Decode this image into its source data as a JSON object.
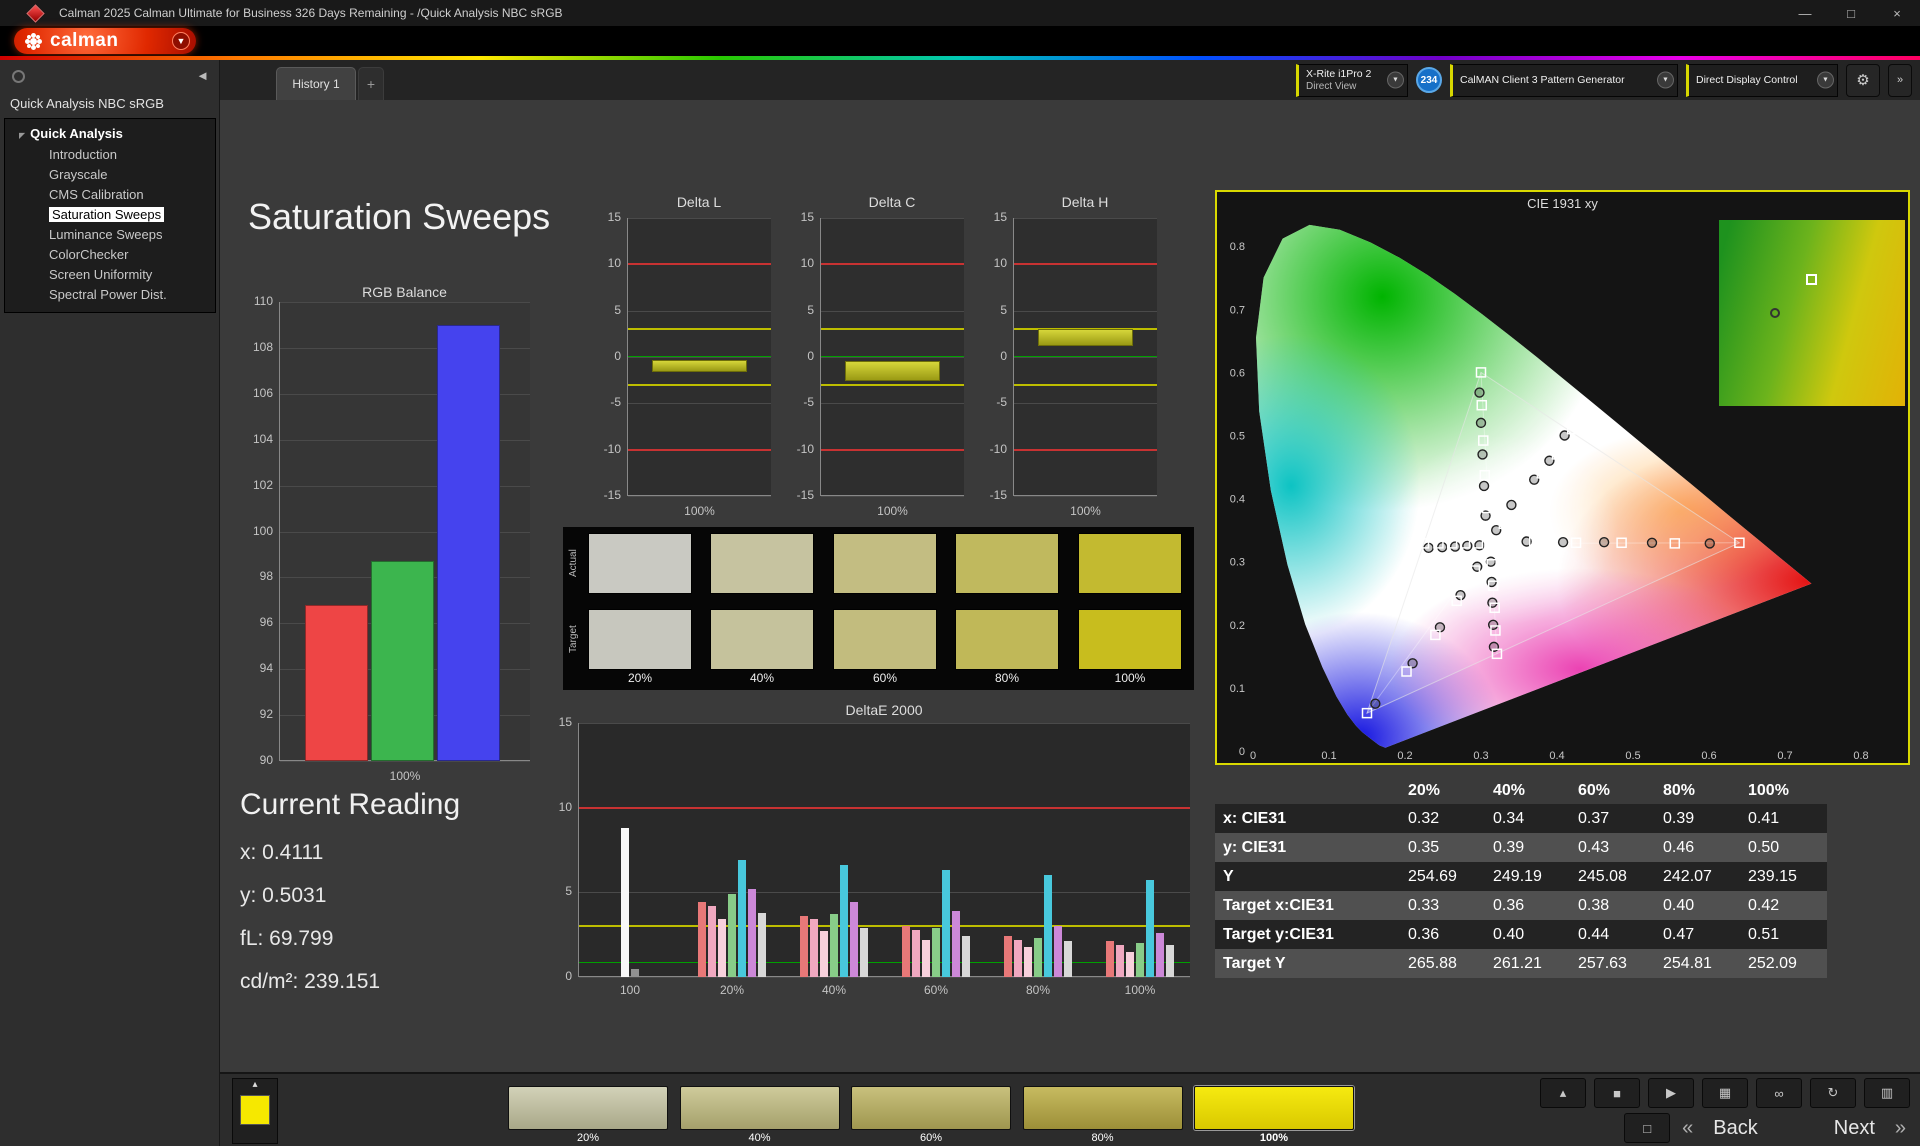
{
  "window": {
    "title": "Calman 2025 Calman Ultimate for Business 326 Days Remaining  - /Quick Analysis NBC sRGB",
    "controls": {
      "minimize": "—",
      "maximize": "□",
      "close": "×"
    }
  },
  "logo": {
    "brand": "calman"
  },
  "sidebar": {
    "panel_title": "Quick Analysis NBC sRGB",
    "tree_root": "Quick Analysis",
    "items": [
      {
        "label": "Introduction",
        "selected": false
      },
      {
        "label": "Grayscale",
        "selected": false
      },
      {
        "label": "CMS Calibration",
        "selected": false
      },
      {
        "label": "Saturation Sweeps",
        "selected": true
      },
      {
        "label": "Luminance Sweeps",
        "selected": false
      },
      {
        "label": "ColorChecker",
        "selected": false
      },
      {
        "label": "Screen Uniformity",
        "selected": false
      },
      {
        "label": "Spectral Power Dist.",
        "selected": false
      }
    ]
  },
  "tabbar": {
    "tab": "History 1",
    "add_tab": "+",
    "meter": {
      "line1": "X-Rite i1Pro 2",
      "line2": "Direct View"
    },
    "badge": "234",
    "pattern_generator": "CalMAN Client 3 Pattern Generator",
    "display_control": "Direct Display Control"
  },
  "page": {
    "title": "Saturation Sweeps"
  },
  "current_reading": {
    "title": "Current Reading",
    "lines": [
      "x: 0.4111",
      "y: 0.5031",
      "fL: 69.799",
      "cd/m²: 239.151"
    ]
  },
  "swatches": {
    "row_labels": [
      "Actual",
      "Target"
    ],
    "labels": [
      "20%",
      "40%",
      "60%",
      "80%",
      "100%"
    ],
    "actual": [
      "#c9c9c2",
      "#c6c3a0",
      "#c3bd82",
      "#c0b95e",
      "#c3ba30"
    ],
    "target": [
      "#c7c7be",
      "#c5c29c",
      "#c2bc7e",
      "#c0b858",
      "#c8bd1e"
    ]
  },
  "table": {
    "headers": [
      "",
      "20%",
      "40%",
      "60%",
      "80%",
      "100%"
    ],
    "rows": [
      {
        "label": "x: CIE31",
        "values": [
          "0.32",
          "0.34",
          "0.37",
          "0.39",
          "0.41"
        ]
      },
      {
        "label": "y: CIE31",
        "values": [
          "0.35",
          "0.39",
          "0.43",
          "0.46",
          "0.50"
        ]
      },
      {
        "label": "Y",
        "values": [
          "254.69",
          "249.19",
          "245.08",
          "242.07",
          "239.15"
        ]
      },
      {
        "label": "Target x:CIE31",
        "values": [
          "0.33",
          "0.36",
          "0.38",
          "0.40",
          "0.42"
        ]
      },
      {
        "label": "Target y:CIE31",
        "values": [
          "0.36",
          "0.40",
          "0.44",
          "0.47",
          "0.51"
        ]
      },
      {
        "label": "Target Y",
        "values": [
          "265.88",
          "261.21",
          "257.63",
          "254.81",
          "252.09"
        ]
      }
    ]
  },
  "bottombar": {
    "back": "Back",
    "next": "Next",
    "patches": [
      {
        "label": "20%",
        "top": "#d2d2b8",
        "bottom": "#a9a888",
        "selected": false
      },
      {
        "label": "40%",
        "top": "#cfcb9b",
        "bottom": "#a5a06b",
        "selected": false
      },
      {
        "label": "60%",
        "top": "#c9c17d",
        "bottom": "#9f964f",
        "selected": false
      },
      {
        "label": "80%",
        "top": "#c7bb60",
        "bottom": "#9c8f38",
        "selected": false
      },
      {
        "label": "100%",
        "top": "#f6ea10",
        "bottom": "#d9c900",
        "selected": true
      }
    ],
    "controls_top": [
      {
        "name": "collapse-up",
        "glyph": "▴"
      },
      {
        "name": "stop",
        "glyph": "■"
      },
      {
        "name": "play",
        "glyph": "▶"
      },
      {
        "name": "save",
        "glyph": "▦"
      },
      {
        "name": "loop",
        "glyph": "∞"
      },
      {
        "name": "refresh",
        "glyph": "↻"
      },
      {
        "name": "grid",
        "glyph": "▥"
      }
    ]
  },
  "chart_data": [
    {
      "id": "rgb_balance",
      "type": "bar",
      "title": "RGB Balance",
      "categories": [
        "100%"
      ],
      "ylim": [
        90,
        110
      ],
      "ytick": 2,
      "series": [
        {
          "name": "Red",
          "color": "#ee4545",
          "values": [
            96.8
          ]
        },
        {
          "name": "Green",
          "color": "#3cb54e",
          "values": [
            98.7
          ]
        },
        {
          "name": "Blue",
          "color": "#4543ee",
          "values": [
            109.0
          ]
        }
      ]
    },
    {
      "id": "delta_l",
      "type": "range-bar",
      "title": "Delta L",
      "xlabel": "100%",
      "ylim": [
        -15,
        15
      ],
      "ytick": 5,
      "limits": {
        "red": [
          10,
          -10
        ],
        "yellow": [
          3,
          -3
        ],
        "green": [
          0
        ]
      },
      "bar": {
        "from": -1.6,
        "to": -0.3
      }
    },
    {
      "id": "delta_c",
      "type": "range-bar",
      "title": "Delta C",
      "xlabel": "100%",
      "ylim": [
        -15,
        15
      ],
      "ytick": 5,
      "limits": {
        "red": [
          10,
          -10
        ],
        "yellow": [
          3,
          -3
        ],
        "green": [
          0
        ]
      },
      "bar": {
        "from": -2.6,
        "to": -0.4
      }
    },
    {
      "id": "delta_h",
      "type": "range-bar",
      "title": "Delta H",
      "xlabel": "100%",
      "ylim": [
        -15,
        15
      ],
      "ytick": 5,
      "limits": {
        "red": [
          10,
          -10
        ],
        "yellow": [
          3,
          -3
        ],
        "green": [
          0
        ]
      },
      "bar": {
        "from": 1.2,
        "to": 3.0
      }
    },
    {
      "id": "deltae2000",
      "type": "grouped-bar",
      "title": "DeltaE 2000",
      "ylim": [
        0,
        15
      ],
      "ytick": 5,
      "limits": {
        "red": [
          10
        ],
        "yellow": [
          3
        ],
        "green": [
          0.8
        ]
      },
      "groups": [
        {
          "label": "100",
          "bars": [
            {
              "color": "#f8f8f8",
              "value": 8.8
            },
            {
              "color": "#909090",
              "value": 0.5
            }
          ]
        },
        {
          "label": "20%",
          "bars": [
            {
              "color": "#e87878",
              "value": 4.4
            },
            {
              "color": "#f0a8c0",
              "value": 4.2
            },
            {
              "color": "#f8d0dc",
              "value": 3.4
            },
            {
              "color": "#88cc88",
              "value": 4.9
            },
            {
              "color": "#48c8dc",
              "value": 6.9
            },
            {
              "color": "#cc88d8",
              "value": 5.2
            },
            {
              "color": "#d8d8d8",
              "value": 3.8
            }
          ]
        },
        {
          "label": "40%",
          "bars": [
            {
              "color": "#e87878",
              "value": 3.6
            },
            {
              "color": "#f0a8c0",
              "value": 3.4
            },
            {
              "color": "#f8d0dc",
              "value": 2.7
            },
            {
              "color": "#88cc88",
              "value": 3.7
            },
            {
              "color": "#48c8dc",
              "value": 6.6
            },
            {
              "color": "#cc88d8",
              "value": 4.4
            },
            {
              "color": "#d8d8d8",
              "value": 2.9
            }
          ]
        },
        {
          "label": "60%",
          "bars": [
            {
              "color": "#e87878",
              "value": 3.0
            },
            {
              "color": "#f0a8c0",
              "value": 2.8
            },
            {
              "color": "#f8d0dc",
              "value": 2.2
            },
            {
              "color": "#88cc88",
              "value": 2.9
            },
            {
              "color": "#48c8dc",
              "value": 6.3
            },
            {
              "color": "#cc88d8",
              "value": 3.9
            },
            {
              "color": "#d8d8d8",
              "value": 2.4
            }
          ]
        },
        {
          "label": "80%",
          "bars": [
            {
              "color": "#e87878",
              "value": 2.4
            },
            {
              "color": "#f0a8c0",
              "value": 2.2
            },
            {
              "color": "#f8d0dc",
              "value": 1.8
            },
            {
              "color": "#88cc88",
              "value": 2.3
            },
            {
              "color": "#48c8dc",
              "value": 6.0
            },
            {
              "color": "#cc88d8",
              "value": 3.0
            },
            {
              "color": "#d8d8d8",
              "value": 2.1
            }
          ]
        },
        {
          "label": "100%",
          "bars": [
            {
              "color": "#e87878",
              "value": 2.1
            },
            {
              "color": "#f0a8c0",
              "value": 1.9
            },
            {
              "color": "#f8d0dc",
              "value": 1.5
            },
            {
              "color": "#88cc88",
              "value": 2.0
            },
            {
              "color": "#48c8dc",
              "value": 5.7
            },
            {
              "color": "#cc88d8",
              "value": 2.6
            },
            {
              "color": "#d8d8d8",
              "value": 1.9
            }
          ]
        }
      ]
    },
    {
      "id": "cie1931",
      "type": "scatter",
      "title": "CIE 1931 xy",
      "xlim": [
        0,
        0.8
      ],
      "ylim": [
        0,
        0.8
      ],
      "tick": 0.1,
      "white_point": [
        0.3127,
        0.329
      ],
      "srgb_triangle": [
        [
          0.64,
          0.33
        ],
        [
          0.3,
          0.6
        ],
        [
          0.15,
          0.06
        ]
      ],
      "inset_markers": {
        "circle": [
          0.3,
          0.5
        ],
        "square": [
          0.5,
          0.32
        ]
      },
      "sweeps": [
        {
          "name": "red",
          "targets": [
            [
              0.37,
              0.331
            ],
            [
              0.425,
              0.33
            ],
            [
              0.485,
              0.33
            ],
            [
              0.555,
              0.329
            ],
            [
              0.64,
              0.33
            ]
          ],
          "measured": [
            [
              0.36,
              0.332
            ],
            [
              0.408,
              0.331
            ],
            [
              0.462,
              0.331
            ],
            [
              0.525,
              0.33
            ],
            [
              0.601,
              0.329
            ]
          ]
        },
        {
          "name": "green",
          "targets": [
            [
              0.308,
              0.385
            ],
            [
              0.305,
              0.437
            ],
            [
              0.303,
              0.492
            ],
            [
              0.301,
              0.548
            ],
            [
              0.3,
              0.6
            ]
          ],
          "measured": [
            [
              0.306,
              0.373
            ],
            [
              0.304,
              0.42
            ],
            [
              0.302,
              0.47
            ],
            [
              0.3,
              0.52
            ],
            [
              0.298,
              0.568
            ]
          ]
        },
        {
          "name": "blue",
          "targets": [
            [
              0.292,
              0.286
            ],
            [
              0.268,
              0.238
            ],
            [
              0.24,
              0.184
            ],
            [
              0.202,
              0.126
            ],
            [
              0.15,
              0.06
            ]
          ],
          "measured": [
            [
              0.295,
              0.292
            ],
            [
              0.273,
              0.247
            ],
            [
              0.246,
              0.196
            ],
            [
              0.21,
              0.139
            ],
            [
              0.161,
              0.075
            ]
          ]
        },
        {
          "name": "cyan",
          "targets": [
            [
              0.296,
              0.329
            ],
            [
              0.279,
              0.329
            ],
            [
              0.262,
              0.329
            ],
            [
              0.244,
              0.329
            ],
            [
              0.225,
              0.329
            ]
          ],
          "measured": [
            [
              0.298,
              0.326
            ],
            [
              0.282,
              0.325
            ],
            [
              0.266,
              0.324
            ],
            [
              0.249,
              0.323
            ],
            [
              0.231,
              0.322
            ]
          ]
        },
        {
          "name": "magenta",
          "targets": [
            [
              0.314,
              0.296
            ],
            [
              0.316,
              0.262
            ],
            [
              0.318,
              0.227
            ],
            [
              0.319,
              0.191
            ],
            [
              0.321,
              0.154
            ]
          ],
          "measured": [
            [
              0.313,
              0.3
            ],
            [
              0.314,
              0.268
            ],
            [
              0.315,
              0.235
            ],
            [
              0.316,
              0.2
            ],
            [
              0.317,
              0.165
            ]
          ]
        },
        {
          "name": "yellow",
          "targets": [
            [
              0.33,
              0.36
            ],
            [
              0.36,
              0.4
            ],
            [
              0.38,
              0.44
            ],
            [
              0.4,
              0.47
            ],
            [
              0.42,
              0.51
            ]
          ],
          "measured": [
            [
              0.32,
              0.35
            ],
            [
              0.34,
              0.39
            ],
            [
              0.37,
              0.43
            ],
            [
              0.39,
              0.46
            ],
            [
              0.41,
              0.5
            ]
          ]
        }
      ]
    }
  ]
}
